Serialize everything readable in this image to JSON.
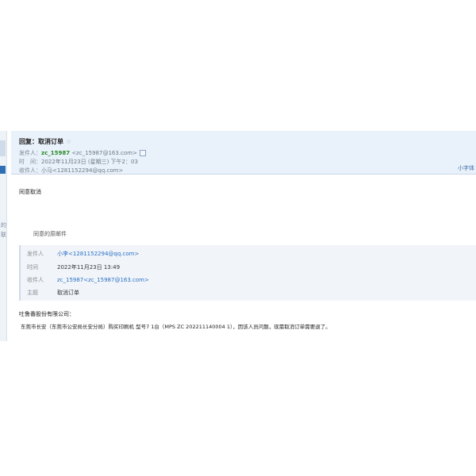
{
  "left_rail": {
    "marks": [
      "的",
      "联"
    ]
  },
  "header": {
    "subject": "回复：取消订单",
    "from_label": "发件人：",
    "from_name": "zc_15987",
    "from_addr": "<zc_15987@163.com>",
    "time_label": "时　间：",
    "time_value": "2022年11月23日 (星期三) 下午2：03",
    "to_label": "收件人：",
    "to_value": "小马<1281152294@qq.com>",
    "fulltext_link": "小字体"
  },
  "body": {
    "line1": "同意取消"
  },
  "original": {
    "label": "同意的原邮件",
    "rows": [
      {
        "key": "发件人",
        "value": "小李<1281152294@qq.com>"
      },
      {
        "key": "时间",
        "value": "2022年11月23日 13:49"
      },
      {
        "key": "收件人",
        "value": "zc_15987<zc_15987@163.com>"
      },
      {
        "key": "主题",
        "value": "取消订单"
      }
    ]
  },
  "message": {
    "greeting": "吐鲁番股份有限公司：",
    "text": "东莞市长安（东莞市公安局长安分局）购买印刷机 型号7 1台（MPS ZC 202211140004 1），因该人员问题，现需取消订单需要退了。"
  },
  "colors": {
    "header_bg": "#e9f1fa",
    "link": "#2b6fc2",
    "sender": "#2a8b2a"
  }
}
